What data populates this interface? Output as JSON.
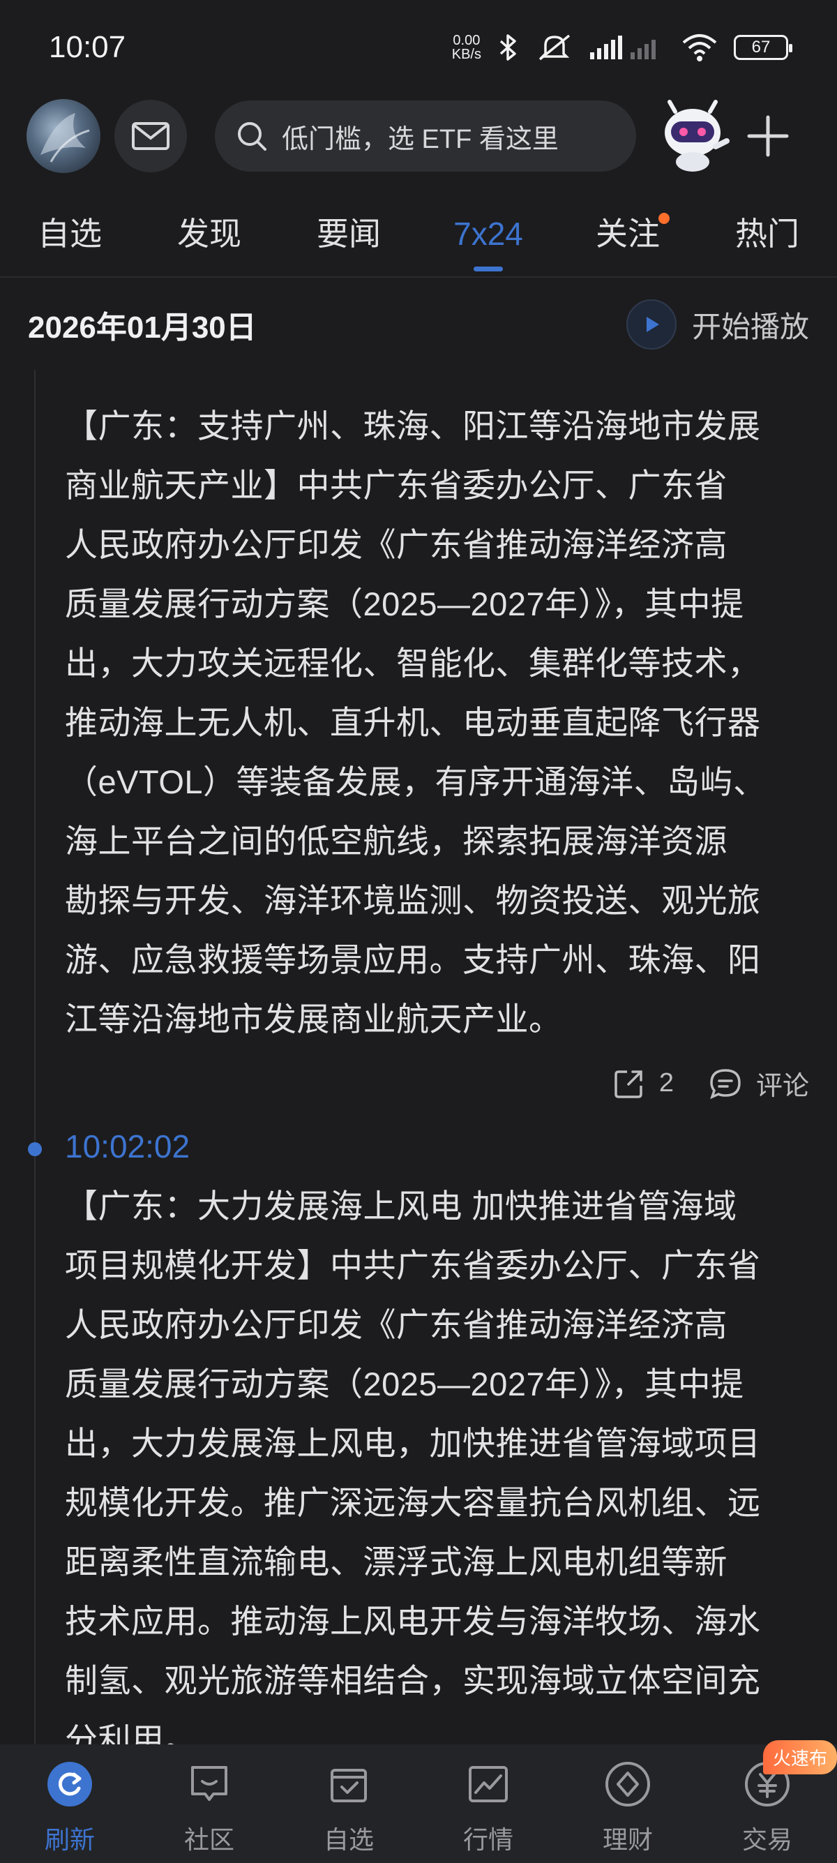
{
  "status": {
    "time": "10:07",
    "net_speed_value": "0.00",
    "net_speed_unit": "KB/s",
    "battery": "67"
  },
  "header": {
    "search_placeholder": "低门槛，选 ETF 看这里"
  },
  "tabs": [
    {
      "label": "自选"
    },
    {
      "label": "发现"
    },
    {
      "label": "要闻"
    },
    {
      "label": "7x24"
    },
    {
      "label": "关注"
    },
    {
      "label": "热门"
    }
  ],
  "date_bar": {
    "date": "2026年01月30日",
    "play_label": "开始播放"
  },
  "news": [
    {
      "lines": [
        "【广东：支持广州、珠海、阳江等沿海地市发展",
        "商业航天产业】中共广东省委办公厅、广东省",
        "人民政府办公厅印发《广东省推动海洋经济高",
        "质量发展行动方案（2025—2027年）》，其中提",
        "出，大力攻关远程化、智能化、集群化等技术，",
        "推动海上无人机、直升机、电动垂直起降飞行器",
        "（eVTOL）等装备发展，有序开通海洋、岛屿、",
        "海上平台之间的低空航线，探索拓展海洋资源",
        "勘探与开发、海洋环境监测、物资投送、观光旅",
        "游、应急救援等场景应用。支持广州、珠海、阳",
        "江等沿海地市发展商业航天产业。"
      ],
      "share_count": "2",
      "comment_label": "评论"
    },
    {
      "time": "10:02:02",
      "lines": [
        "【广东：大力发展海上风电 加快推进省管海域",
        "项目规模化开发】中共广东省委办公厅、广东省",
        "人民政府办公厅印发《广东省推动海洋经济高",
        "质量发展行动方案（2025—2027年）》，其中提",
        "出，大力发展海上风电，加快推进省管海域项目",
        "规模化开发。推广深远海大容量抗台风机组、远",
        "距离柔性直流输电、漂浮式海上风电机组等新",
        "技术应用。推动海上风电开发与海洋牧场、海水",
        "制氢、观光旅游等相结合，实现海域立体空间充",
        "分利用。"
      ]
    }
  ],
  "bottom_nav": [
    {
      "label": "刷新",
      "icon": "refresh-icon"
    },
    {
      "label": "社区",
      "icon": "community-icon"
    },
    {
      "label": "自选",
      "icon": "watchlist-icon"
    },
    {
      "label": "行情",
      "icon": "market-icon"
    },
    {
      "label": "理财",
      "icon": "wealth-icon"
    },
    {
      "label": "交易",
      "icon": "trade-icon"
    }
  ],
  "promo_badge": "火速布",
  "colors": {
    "accent": "#3d74d0",
    "background": "#1c1c1e",
    "notification_dot": "#ff6f2c"
  }
}
